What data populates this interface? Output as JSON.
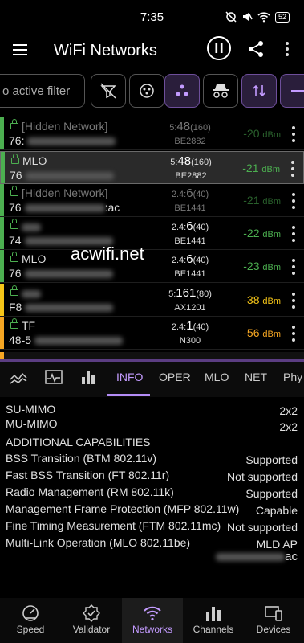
{
  "status_bar": {
    "time": "7:35",
    "battery": "52"
  },
  "app_bar": {
    "title": "WiFi Networks"
  },
  "filter": {
    "placeholder": "o active filter"
  },
  "networks": [
    {
      "ssid": "[Hidden Network]",
      "bssid_prefix": "76:",
      "bssid_suffix": "",
      "channel_band": "5:",
      "channel": "48",
      "width": "(160)",
      "model": "BE2882",
      "dbm": "-20",
      "color": "#4caf50",
      "dim": true
    },
    {
      "ssid": "MLO",
      "bssid_prefix": "76",
      "bssid_suffix": "",
      "channel_band": "5:",
      "channel": "48",
      "width": "(160)",
      "model": "BE2882",
      "dbm": "-21",
      "color": "#4caf50",
      "dim": false
    },
    {
      "ssid": "[Hidden Network]",
      "bssid_prefix": "76",
      "bssid_suffix": ":ac",
      "channel_band": "2.4:",
      "channel": "6",
      "width": "(40)",
      "model": "BE1441",
      "dbm": "-21",
      "color": "#4caf50",
      "dim": true
    },
    {
      "ssid": "",
      "bssid_prefix": "74",
      "bssid_suffix": "",
      "channel_band": "2.4:",
      "channel": "6",
      "width": "(40)",
      "model": "BE1441",
      "dbm": "-22",
      "color": "#4caf50",
      "dim": false
    },
    {
      "ssid": "MLO",
      "bssid_prefix": "76",
      "bssid_suffix": "",
      "channel_band": "2.4:",
      "channel": "6",
      "width": "(40)",
      "model": "BE1441",
      "dbm": "-23",
      "color": "#4caf50",
      "dim": false
    },
    {
      "ssid": "",
      "bssid_prefix": "F8",
      "bssid_suffix": "",
      "channel_band": "5:",
      "channel": "161",
      "width": "(80)",
      "model": "AX1201",
      "dbm": "-38",
      "color": "#f5c518",
      "dim": false
    },
    {
      "ssid": "TF",
      "bssid_prefix": "48-5",
      "bssid_suffix": "",
      "channel_band": "2.4:",
      "channel": "1",
      "width": "(40)",
      "model": "N300",
      "dbm": "-56",
      "color": "#f5a623",
      "dim": false
    }
  ],
  "dbm_unit": "dBm",
  "watermark": "acwifi.net",
  "tabs": [
    "INFO",
    "OPER",
    "MLO",
    "NET",
    "Phy"
  ],
  "detail": {
    "rows_top": [
      {
        "label": "SU-MIMO",
        "value": "2x2"
      },
      {
        "label": "MU-MIMO",
        "value": "2x2"
      }
    ],
    "section_title": "ADDITIONAL CAPABILITIES",
    "rows": [
      {
        "label": "BSS Transition (BTM 802.11v)",
        "value": "Supported"
      },
      {
        "label": "Fast BSS Transition (FT 802.11r)",
        "value": "Not supported"
      },
      {
        "label": "Radio Management (RM 802.11k)",
        "value": "Supported"
      },
      {
        "label": "Management Frame Protection (MFP 802.11w)",
        "value": "Capable"
      },
      {
        "label": "Fine Timing Measurement (FTM 802.11mc)",
        "value": "Not supported"
      },
      {
        "label": "Multi-Link Operation (MLO 802.11be)",
        "value": "MLD AP"
      }
    ],
    "mld_suffix": "ac"
  },
  "bottom_nav": [
    {
      "label": "Speed",
      "icon": "speedometer-icon"
    },
    {
      "label": "Validator",
      "icon": "checkmark-badge-icon"
    },
    {
      "label": "Networks",
      "icon": "wifi-icon"
    },
    {
      "label": "Channels",
      "icon": "bar-chart-icon"
    },
    {
      "label": "Devices",
      "icon": "devices-icon"
    }
  ]
}
